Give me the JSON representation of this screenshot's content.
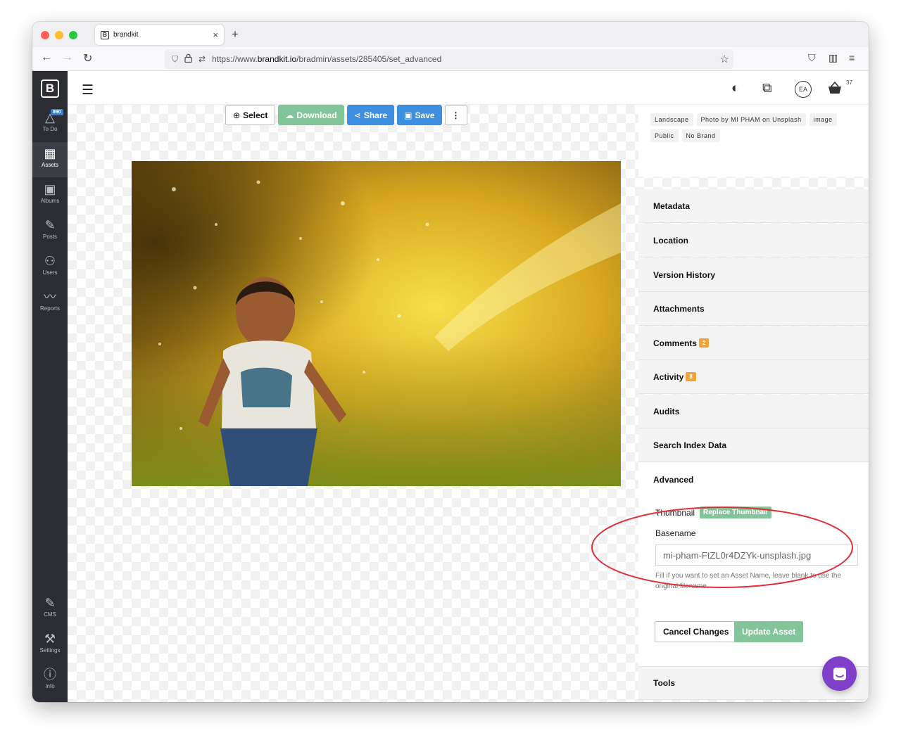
{
  "browser": {
    "tab_title": "brandkit",
    "tab_favicon": "B",
    "close_glyph": "×",
    "new_tab_glyph": "+",
    "url_prefix": "https://www.",
    "url_domain": "brandkit.io",
    "url_path": "/bradmin/assets/285405/set_advanced"
  },
  "sidebar": {
    "logo": "B",
    "todo_badge": "890",
    "items": [
      {
        "label": "To Do",
        "icon": "warning-triangle-icon"
      },
      {
        "label": "Assets",
        "icon": "grid-icon"
      },
      {
        "label": "Albums",
        "icon": "image-icon"
      },
      {
        "label": "Posts",
        "icon": "edit-icon"
      },
      {
        "label": "Users",
        "icon": "users-icon"
      },
      {
        "label": "Reports",
        "icon": "pulse-icon"
      },
      {
        "label": "CMS",
        "icon": "edit-icon"
      },
      {
        "label": "Settings",
        "icon": "wrench-icon"
      },
      {
        "label": "Info",
        "icon": "info-icon"
      }
    ]
  },
  "header": {
    "avatar_initials": "EA",
    "cart_count": "37"
  },
  "toolbar": {
    "select": "Select",
    "download": "Download",
    "share": "Share",
    "save": "Save",
    "more": "⋮"
  },
  "tags": [
    "Landscape",
    "Photo by MI PHAM on Unsplash",
    "image",
    "Public",
    "No Brand"
  ],
  "accordion": {
    "metadata": "Metadata",
    "location": "Location",
    "version_history": "Version History",
    "attachments": "Attachments",
    "comments": "Comments",
    "comments_count": "2",
    "activity": "Activity",
    "activity_count": "8",
    "audits": "Audits",
    "search_index": "Search Index Data",
    "tools": "Tools"
  },
  "advanced": {
    "title": "Advanced",
    "thumbnail_label": "Thumbnail",
    "replace_thumbnail": "Replace Thumbnail",
    "basename_label": "Basename",
    "basename_value": "mi-pham-FtZL0r4DZYk-unsplash.jpg",
    "help_text": "Fill if you want to set an Asset Name, leave blank to use the original filename.",
    "cancel": "Cancel Changes",
    "update": "Update Asset"
  },
  "colors": {
    "sidebar_bg": "#2c2d33",
    "green_button": "#82c59a",
    "blue_button": "#3d8fe0",
    "badge_orange": "#f0a23b",
    "annotation_red": "#e0313a",
    "chat_purple": "#7f3fc9"
  }
}
